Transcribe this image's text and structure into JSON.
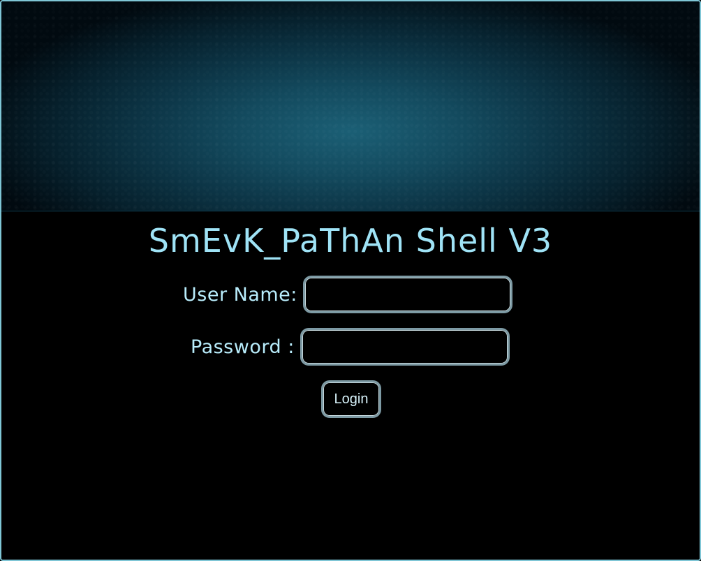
{
  "page": {
    "title": "SmEvK_PaThAn Shell V3"
  },
  "login_form": {
    "username_label": "User Name:",
    "username_value": "",
    "password_label": "Password :",
    "password_value": "",
    "login_button_label": "Login"
  },
  "colors": {
    "background": "#000000",
    "title_text": "#9fe3f6",
    "label_text": "#b8ecfb",
    "field_border": "#7d9aa4",
    "frame_border": "#7fc6d6",
    "banner_accent": "#1b5f75"
  }
}
